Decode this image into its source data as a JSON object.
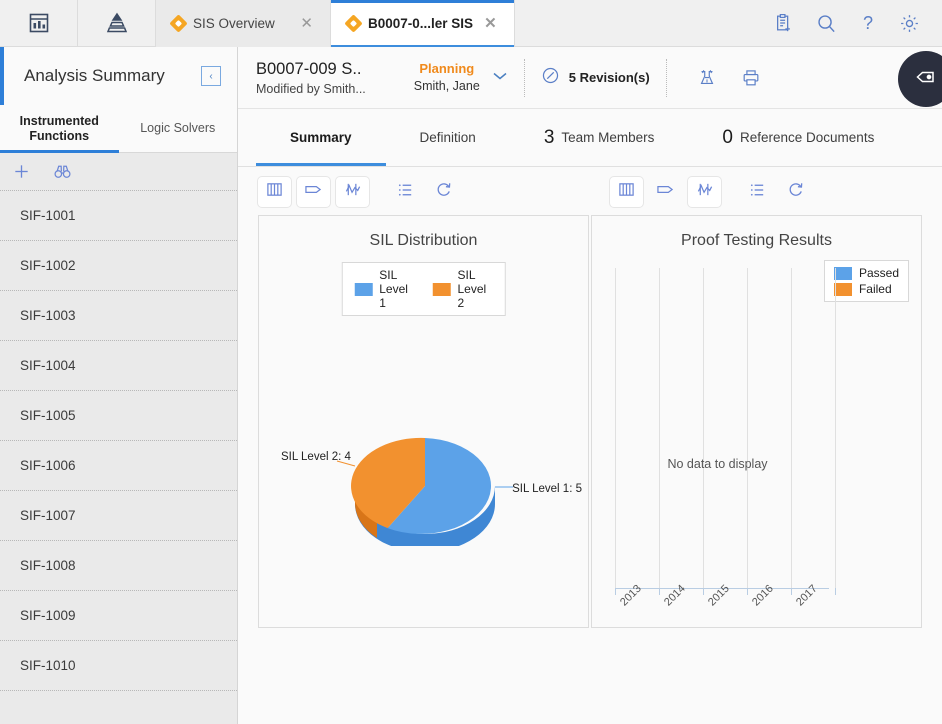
{
  "topbar": {
    "app_icon": "dashboard-icon",
    "hierarchy_icon": "pyramid-icon",
    "tabs": [
      {
        "label": "SIS Overview",
        "icon": "diamond-icon",
        "active": false
      },
      {
        "label": "B0007-0...ler SIS",
        "icon": "diamond-icon",
        "active": true
      }
    ],
    "close_glyph": "✕",
    "actions": [
      {
        "name": "clipboard-add-icon"
      },
      {
        "name": "search-icon"
      },
      {
        "name": "help-icon",
        "glyph": "?"
      },
      {
        "name": "gear-icon"
      }
    ]
  },
  "sidebar": {
    "title": "Analysis Summary",
    "collapse_glyph": "‹",
    "tabs": [
      {
        "label": "Instrumented Functions",
        "active": true
      },
      {
        "label": "Logic Solvers",
        "active": false
      }
    ],
    "toolbar": [
      {
        "name": "add-icon"
      },
      {
        "name": "binoculars-icon"
      }
    ],
    "items": [
      {
        "label": "SIF-1001"
      },
      {
        "label": "SIF-1002"
      },
      {
        "label": "SIF-1003"
      },
      {
        "label": "SIF-1004"
      },
      {
        "label": "SIF-1005"
      },
      {
        "label": "SIF-1006"
      },
      {
        "label": "SIF-1007"
      },
      {
        "label": "SIF-1008"
      },
      {
        "label": "SIF-1009"
      },
      {
        "label": "SIF-1010"
      }
    ]
  },
  "record": {
    "title": "B0007-009 S..",
    "subtitle": "Modified by Smith...",
    "state_name": "Planning",
    "state_user": "Smith, Jane",
    "state_chevron": "⌄",
    "revisions_label": "5 Revision(s)",
    "revisions_icon": "pencil-circle-icon",
    "actions": [
      {
        "name": "export-icon"
      },
      {
        "name": "print-icon"
      }
    ],
    "fab_icon": "tag-icon"
  },
  "content_tabs": [
    {
      "label": "Summary",
      "count": "",
      "active": true
    },
    {
      "label": "Definition",
      "count": "",
      "active": false
    },
    {
      "label": "Team Members",
      "count": "3",
      "active": false
    },
    {
      "label": "Reference Documents",
      "count": "0",
      "active": false
    }
  ],
  "chart_toolbars": [
    {
      "buttons": [
        {
          "name": "book-icon",
          "boxed": true
        },
        {
          "name": "tag-outline-icon",
          "boxed": true
        },
        {
          "name": "trend-icon",
          "boxed": true
        },
        {
          "name": "list-icon",
          "boxed": false
        },
        {
          "name": "refresh-icon",
          "boxed": false
        }
      ]
    },
    {
      "buttons": [
        {
          "name": "book-icon",
          "boxed": true
        },
        {
          "name": "tag-outline-icon",
          "boxed": false
        },
        {
          "name": "trend-icon",
          "boxed": true
        },
        {
          "name": "list-icon",
          "boxed": false
        },
        {
          "name": "refresh-icon",
          "boxed": false
        }
      ]
    }
  ],
  "colors": {
    "blue": "#5CA2E8",
    "blue_dark": "#3F87D4",
    "orange": "#F2912F",
    "orange_dark": "#D87518",
    "accent": "#2e7fd8",
    "state": "#f08a1c"
  },
  "chart_data": [
    {
      "type": "pie",
      "title": "SIL Distribution",
      "categories": [
        "SIL Level 1",
        "SIL Level 2"
      ],
      "values": [
        5,
        4
      ],
      "colors": [
        "#5CA2E8",
        "#F2912F"
      ],
      "legend": [
        "SIL Level 1",
        "SIL Level 2"
      ],
      "legend_position": "top",
      "data_labels": [
        "SIL Level 1: 5",
        "SIL Level 2: 4"
      ],
      "three_d": true
    },
    {
      "type": "bar",
      "title": "Proof Testing Results",
      "categories": [
        "2013",
        "2014",
        "2015",
        "2016",
        "2017"
      ],
      "series": [
        {
          "name": "Passed",
          "values": []
        },
        {
          "name": "Failed",
          "values": []
        }
      ],
      "legend": [
        "Passed",
        "Failed"
      ],
      "legend_position": "top-right",
      "colors": [
        "#5CA2E8",
        "#F2912F"
      ],
      "empty_message": "No data to display",
      "grid": true,
      "xlabel": "",
      "ylabel": ""
    }
  ]
}
